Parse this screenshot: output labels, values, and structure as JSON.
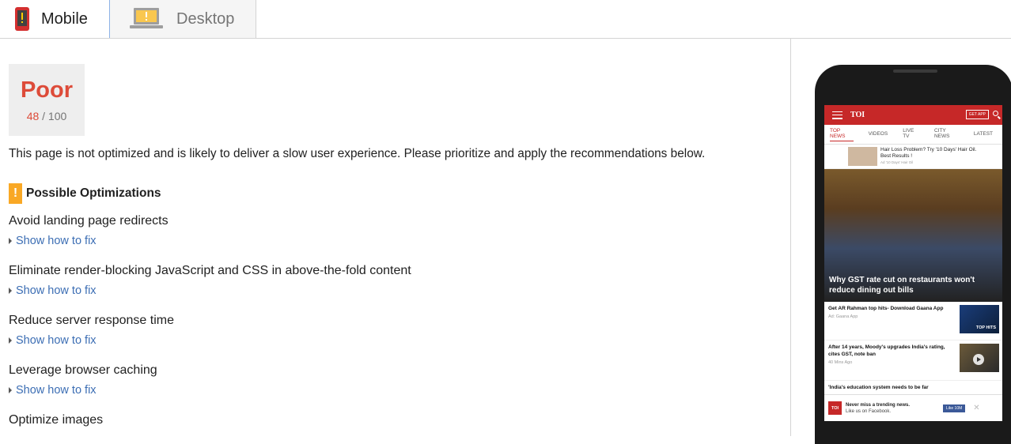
{
  "tabs": [
    {
      "label": "Mobile",
      "active": true
    },
    {
      "label": "Desktop",
      "active": false
    }
  ],
  "score": {
    "label": "Poor",
    "value": "48",
    "max": "/ 100",
    "color": "#dd4b39"
  },
  "summary": "This page is not optimized and is likely to deliver a slow user experience. Please prioritize and apply the recommendations below.",
  "optimizations": {
    "heading": "Possible Optimizations",
    "warn_glyph": "!",
    "fix_label": "Show how to fix",
    "rules": [
      "Avoid landing page redirects",
      "Eliminate render-blocking JavaScript and CSS in above-the-fold content",
      "Reduce server response time",
      "Leverage browser caching",
      "Optimize images"
    ]
  },
  "phone_preview": {
    "brand": "TOI",
    "get_app": "GET APP",
    "nav": [
      "TOP NEWS",
      "VIDEOS",
      "LIVE TV",
      "CITY NEWS",
      "LATEST"
    ],
    "ad": {
      "text": "Hair Loss Problem? Try '10 Days' Hair Oil. Best Results !",
      "source": "Ad '10 Days' Hair Oil"
    },
    "hero_caption": "Why GST rate cut on restaurants won't reduce dining out bills",
    "stories": [
      {
        "title": "Get AR Rahman top hits- Download Gaana App",
        "meta": "Ad: Gaana App",
        "thumb_label": "TOP HITS"
      },
      {
        "title": "After 14 years, Moody's upgrades India's rating, cites GST, note ban",
        "meta": "40 Mins Ago"
      },
      {
        "title": "'India's education system needs to be far",
        "meta": ""
      }
    ],
    "fb_bar": {
      "logo": "TOI",
      "title": "Never miss a trending news.",
      "subtitle": "Like us on Facebook.",
      "like": "Like 10M",
      "close": "✕"
    }
  },
  "colors": {
    "accent_blue": "#3c6eb4",
    "warning": "#f9a825",
    "poor": "#dd4b39",
    "toi_red": "#c62828"
  },
  "icons": {
    "mobile_tab": "mobile-phone-icon",
    "desktop_tab": "laptop-icon"
  }
}
